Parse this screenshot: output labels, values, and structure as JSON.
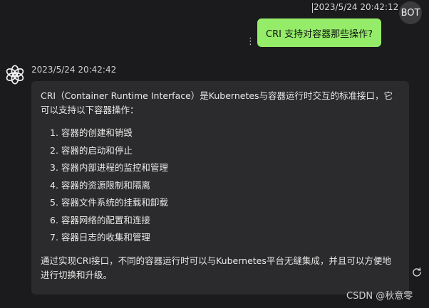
{
  "user_message": {
    "timestamp": "2023/5/24 20:42:12",
    "avatar_label": "BOT",
    "text": "CRI 支持对容器那些操作?",
    "menu_icon": "more-vertical-icon"
  },
  "assistant_message": {
    "timestamp": "2023/5/24 20:42:42",
    "avatar_icon": "openai-logo-icon",
    "intro": "CRI（Container Runtime Interface）是Kubernetes与容器运行时交互的标准接口，它可以支持以下容器操作：",
    "items": [
      "1. 容器的创建和销毁",
      "2. 容器的启动和停止",
      "3. 容器内部进程的监控和管理",
      "4. 容器的资源限制和隔离",
      "5. 容器文件系统的挂载和卸载",
      "6. 容器网络的配置和连接",
      "7. 容器日志的收集和管理"
    ],
    "outro": "通过实现CRI接口，不同的容器运行时可以与Kubernetes平台无缝集成，并且可以方便地进行切换和升级。",
    "regenerate_icon": "refresh-icon"
  },
  "watermark": "CSDN @秋意零",
  "colors": {
    "background": "#1b1b1d",
    "user_bubble": "#95ec69",
    "assistant_bubble": "#2b2b2d"
  }
}
